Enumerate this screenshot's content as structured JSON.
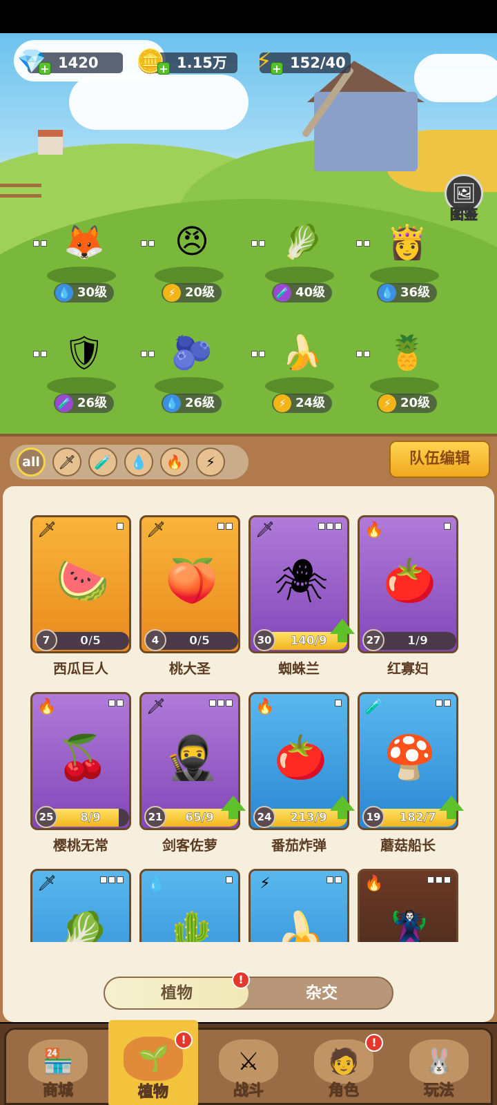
{
  "resources": {
    "gems": "1420",
    "coins": "1.15万",
    "energy": "152/40"
  },
  "codex": {
    "label": "图鉴"
  },
  "team": [
    {
      "level": "30级",
      "element": "water",
      "emoji": "🦊"
    },
    {
      "level": "20级",
      "element": "lightning",
      "emoji": "😠"
    },
    {
      "level": "40级",
      "element": "potion",
      "emoji": "🥬"
    },
    {
      "level": "36级",
      "element": "water",
      "emoji": "👸"
    },
    {
      "level": "26级",
      "element": "potion",
      "emoji": "🛡"
    },
    {
      "level": "26级",
      "element": "water",
      "emoji": "🫐"
    },
    {
      "level": "24级",
      "element": "lightning",
      "emoji": "🍌"
    },
    {
      "level": "20级",
      "element": "lightning",
      "emoji": "🍍"
    }
  ],
  "filters": {
    "all_label": "all",
    "icons": [
      "sword-icon",
      "potion-icon",
      "water-drop-icon",
      "fire-icon",
      "lightning-icon"
    ],
    "team_edit": "队伍编辑"
  },
  "cards": [
    {
      "name": "西瓜巨人",
      "level": "7",
      "progress": "0/5",
      "fill": 0,
      "color": "orange",
      "element": "sword",
      "upgrade": false,
      "emoji": "🍉"
    },
    {
      "name": "桃大圣",
      "level": "4",
      "progress": "0/5",
      "fill": 0,
      "color": "orange",
      "element": "sword",
      "upgrade": false,
      "emoji": "🍑"
    },
    {
      "name": "蜘蛛兰",
      "level": "30",
      "progress": "140/9",
      "fill": 1,
      "color": "purple",
      "element": "sword",
      "upgrade": true,
      "emoji": "🕷"
    },
    {
      "name": "红寡妇",
      "level": "27",
      "progress": "1/9",
      "fill": 0.11,
      "color": "purple",
      "element": "fire",
      "upgrade": false,
      "emoji": "🍅"
    },
    {
      "name": "樱桃无常",
      "level": "25",
      "progress": "8/9",
      "fill": 0.89,
      "color": "purple",
      "element": "fire",
      "upgrade": false,
      "emoji": "🍒"
    },
    {
      "name": "剑客佐萝",
      "level": "21",
      "progress": "65/9",
      "fill": 1,
      "color": "purple",
      "element": "sword",
      "upgrade": true,
      "emoji": "🥷"
    },
    {
      "name": "番茄炸弹",
      "level": "24",
      "progress": "213/9",
      "fill": 1,
      "color": "blue",
      "element": "fire",
      "upgrade": true,
      "emoji": "🍅"
    },
    {
      "name": "蘑菇船长",
      "level": "19",
      "progress": "182/7",
      "fill": 1,
      "color": "blue",
      "element": "potion",
      "upgrade": true,
      "emoji": "🍄"
    },
    {
      "name": "",
      "level": "",
      "progress": "",
      "fill": 0,
      "color": "blue",
      "element": "sword",
      "upgrade": false,
      "emoji": "🥬"
    },
    {
      "name": "",
      "level": "",
      "progress": "",
      "fill": 0,
      "color": "blue",
      "element": "water",
      "upgrade": false,
      "emoji": "🌵"
    },
    {
      "name": "",
      "level": "",
      "progress": "",
      "fill": 0,
      "color": "blue",
      "element": "lightning",
      "upgrade": false,
      "emoji": "🍌"
    },
    {
      "name": "",
      "level": "",
      "progress": "",
      "fill": 0,
      "color": "dark",
      "element": "fire",
      "upgrade": false,
      "emoji": "🦹"
    }
  ],
  "subtabs": {
    "plants": "植物",
    "hybrid": "杂交",
    "badge": "!"
  },
  "nav": [
    {
      "label": "商城",
      "emoji": "🏪",
      "badge": false
    },
    {
      "label": "植物",
      "emoji": "🌱",
      "badge": true
    },
    {
      "label": "战斗",
      "emoji": "⚔",
      "badge": false
    },
    {
      "label": "角色",
      "emoji": "🧑",
      "badge": true
    },
    {
      "label": "玩法",
      "emoji": "🐰",
      "badge": false
    }
  ],
  "colors": {
    "frame_brown": "#b07a4d",
    "panel_cream": "#f6efdd",
    "gold_button": "#f0a81d",
    "upgrade_green": "#5fc12a",
    "badge_red": "#e4382c"
  }
}
